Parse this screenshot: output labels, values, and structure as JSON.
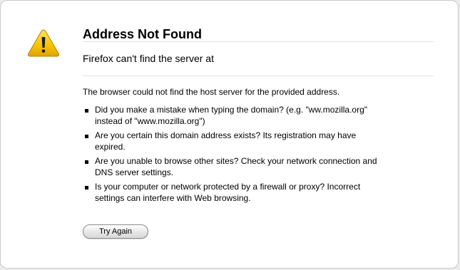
{
  "error": {
    "title": "Address Not Found",
    "short_description": "Firefox can't find the server at",
    "long_description": "The browser could not find the host server for the provided address.",
    "suggestions": [
      {
        "line1": "Did you make a mistake when typing the domain? (e.g. \"ww.mozilla.org\"",
        "line2": "instead of \"www.mozilla.org\")"
      },
      {
        "line1": "Are you certain this domain address exists? Its registration may have",
        "line2": "expired."
      },
      {
        "line1": "Are you unable to browse other sites? Check your network connection and",
        "line2": "DNS server settings."
      },
      {
        "line1": "Is your computer or network protected by a firewall or proxy? Incorrect",
        "line2": "settings can interfere with Web browsing."
      }
    ],
    "try_again_label": "Try Again",
    "icon": "warning-triangle-icon",
    "colors": {
      "icon_fill": "#f5c000",
      "icon_border": "#b08000",
      "divider": "#e1e1e1"
    }
  }
}
